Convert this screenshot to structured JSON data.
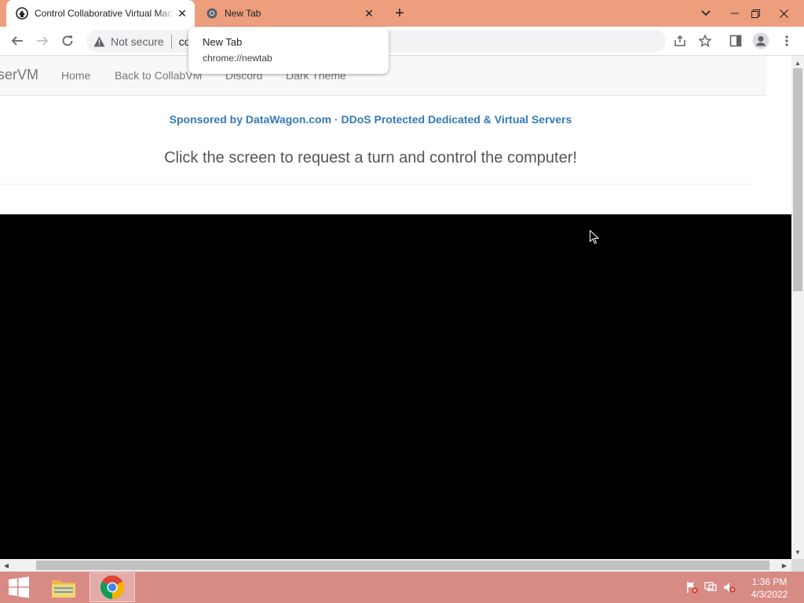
{
  "browser": {
    "tabs": [
      {
        "title": "Control Collaborative Virtual Machines",
        "favicon": "collabvm-icon",
        "active": true
      },
      {
        "title": "New Tab",
        "favicon": "chrome-icon",
        "active": false
      }
    ],
    "new_tab_symbol": "+",
    "close_symbol": "✕",
    "address_bar": {
      "security_label": "Not secure",
      "url_text": "co"
    },
    "hover_card": {
      "title": "New Tab",
      "url": "chrome://newtab"
    },
    "colors": {
      "tab_strip": "#ec9e7d",
      "toolbar": "#ffffff",
      "omnibox": "#f1f3f4"
    }
  },
  "page": {
    "navbar": {
      "brand": "serVM",
      "links": [
        "Home",
        "Back to CollabVM",
        "Discord",
        "Dark Theme"
      ]
    },
    "sponsor_text": "Sponsored by DataWagon.com · DDoS Protected Dedicated & Virtual Servers",
    "headline": "Click the screen to request a turn and control the computer!",
    "colors": {
      "link": "#337ab7",
      "vm_screen": "#000000"
    }
  },
  "taskbar": {
    "apps": [
      "file-explorer-icon",
      "chrome-icon"
    ],
    "tray_icons": [
      "action-center-flag-icon",
      "network-icon",
      "volume-muted-icon"
    ],
    "clock": {
      "time": "1:36 PM",
      "date": "4/3/2022"
    },
    "color": "#d88a84"
  }
}
